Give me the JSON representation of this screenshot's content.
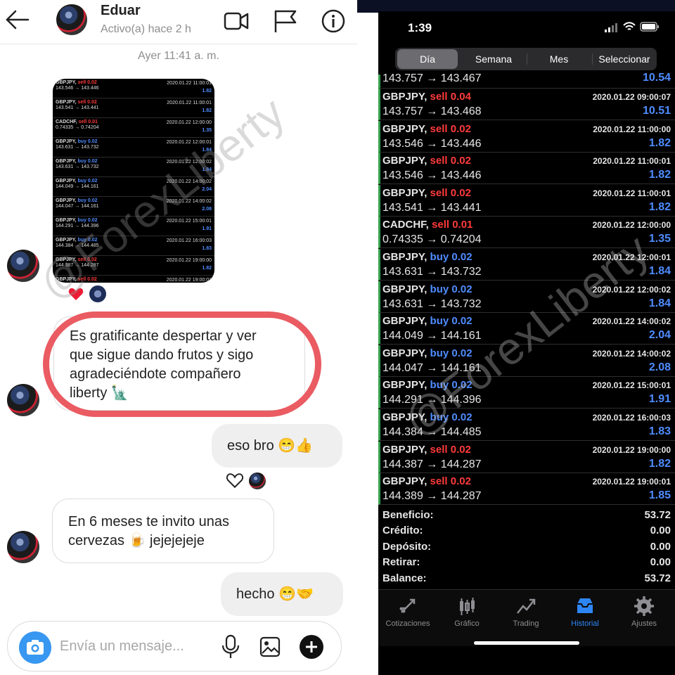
{
  "chat": {
    "contact_name": "Eduar",
    "status": "Activo(a) hace 2 h",
    "date_stamp": "Ayer 11:41 a. m.",
    "image_rows": [
      {
        "symbol": "GBPJPY,",
        "side": "sell 0.02",
        "side_type": "sell",
        "date": "2020.01.22 11:00:01",
        "prices": "143.546 → 143.446",
        "profit": "1.82"
      },
      {
        "symbol": "GBPJPY,",
        "side": "sell 0.02",
        "side_type": "sell",
        "date": "2020.01.22 11:00:01",
        "prices": "143.541 → 143.441",
        "profit": "1.82"
      },
      {
        "symbol": "CADCHF,",
        "side": "sell 0.01",
        "side_type": "sell",
        "date": "2020.01.22 12:00:00",
        "prices": "0.74335 → 0.74204",
        "profit": "1.35"
      },
      {
        "symbol": "GBPJPY,",
        "side": "buy 0.02",
        "side_type": "buy",
        "date": "2020.01.22 12:00:01",
        "prices": "143.631 → 143.732",
        "profit": "1.84"
      },
      {
        "symbol": "GBPJPY,",
        "side": "buy 0.02",
        "side_type": "buy",
        "date": "2020.01.22 12:00:02",
        "prices": "143.631 → 143.732",
        "profit": "1.84"
      },
      {
        "symbol": "GBPJPY,",
        "side": "buy 0.02",
        "side_type": "buy",
        "date": "2020.01.22 14:00:02",
        "prices": "144.049 → 144.161",
        "profit": "2.04"
      },
      {
        "symbol": "GBPJPY,",
        "side": "buy 0.02",
        "side_type": "buy",
        "date": "2020.01.22 14:00:02",
        "prices": "144.047 → 144.161",
        "profit": "2.08"
      },
      {
        "symbol": "GBPJPY,",
        "side": "buy 0.02",
        "side_type": "buy",
        "date": "2020.01.22 15:00:01",
        "prices": "144.291 → 144.396",
        "profit": "1.91"
      },
      {
        "symbol": "GBPJPY,",
        "side": "buy 0.02",
        "side_type": "buy",
        "date": "2020.01.22 16:00:03",
        "prices": "144.384 → 144.485",
        "profit": "1.83"
      },
      {
        "symbol": "GBPJPY,",
        "side": "sell 0.02",
        "side_type": "sell",
        "date": "2020.01.22 19:00:00",
        "prices": "144.387 → 144.287",
        "profit": "1.82"
      },
      {
        "symbol": "GBPJPY,",
        "side": "sell 0.02",
        "side_type": "sell",
        "date": "2020.01.22 19:00:01",
        "prices": "144.389 → 144.287",
        "profit": "1.85"
      }
    ],
    "messages": [
      {
        "dir": "in",
        "text_lines": [
          "Es gratificante despertar y ver",
          "que sigue dando frutos y sigo",
          "agradeciéndote compañero",
          "liberty 🗽"
        ]
      },
      {
        "dir": "out",
        "text_lines": [
          "eso bro 😁👍"
        ]
      },
      {
        "dir": "in",
        "text_lines": [
          "En 6 meses te invito unas",
          "cervezas 🍺 jejejejeje"
        ]
      },
      {
        "dir": "out",
        "text_lines": [
          "hecho 😁🤝"
        ]
      }
    ],
    "composer_placeholder": "Envía un mensaje..."
  },
  "watermark": "@ForexLiberty",
  "trading": {
    "status_time": "1:39",
    "segments": [
      "Día",
      "Semana",
      "Mes",
      "Seleccionar"
    ],
    "selected_segment": "Día",
    "partial_first_row": {
      "prices": "143.757 → 143.467",
      "profit": "10.54"
    },
    "trades": [
      {
        "symbol": "GBPJPY,",
        "side": "sell 0.04",
        "side_type": "sell",
        "date": "2020.01.22 09:00:07",
        "prices": "143.757 → 143.468",
        "profit": "10.51"
      },
      {
        "symbol": "GBPJPY,",
        "side": "sell 0.02",
        "side_type": "sell",
        "date": "2020.01.22 11:00:00",
        "prices": "143.546 → 143.446",
        "profit": "1.82"
      },
      {
        "symbol": "GBPJPY,",
        "side": "sell 0.02",
        "side_type": "sell",
        "date": "2020.01.22 11:00:01",
        "prices": "143.546 → 143.446",
        "profit": "1.82"
      },
      {
        "symbol": "GBPJPY,",
        "side": "sell 0.02",
        "side_type": "sell",
        "date": "2020.01.22 11:00:01",
        "prices": "143.541 → 143.441",
        "profit": "1.82"
      },
      {
        "symbol": "CADCHF,",
        "side": "sell 0.01",
        "side_type": "sell",
        "date": "2020.01.22 12:00:00",
        "prices": "0.74335 → 0.74204",
        "profit": "1.35"
      },
      {
        "symbol": "GBPJPY,",
        "side": "buy 0.02",
        "side_type": "buy",
        "date": "2020.01.22 12:00:01",
        "prices": "143.631 → 143.732",
        "profit": "1.84"
      },
      {
        "symbol": "GBPJPY,",
        "side": "buy 0.02",
        "side_type": "buy",
        "date": "2020.01.22 12:00:02",
        "prices": "143.631 → 143.732",
        "profit": "1.84"
      },
      {
        "symbol": "GBPJPY,",
        "side": "buy 0.02",
        "side_type": "buy",
        "date": "2020.01.22 14:00:02",
        "prices": "144.049 → 144.161",
        "profit": "2.04"
      },
      {
        "symbol": "GBPJPY,",
        "side": "buy 0.02",
        "side_type": "buy",
        "date": "2020.01.22 14:00:02",
        "prices": "144.047 → 144.161",
        "profit": "2.08"
      },
      {
        "symbol": "GBPJPY,",
        "side": "buy 0.02",
        "side_type": "buy",
        "date": "2020.01.22 15:00:01",
        "prices": "144.291 → 144.396",
        "profit": "1.91"
      },
      {
        "symbol": "GBPJPY,",
        "side": "buy 0.02",
        "side_type": "buy",
        "date": "2020.01.22 16:00:03",
        "prices": "144.384 → 144.485",
        "profit": "1.83"
      },
      {
        "symbol": "GBPJPY,",
        "side": "sell 0.02",
        "side_type": "sell",
        "date": "2020.01.22 19:00:00",
        "prices": "144.387 → 144.287",
        "profit": "1.82"
      },
      {
        "symbol": "GBPJPY,",
        "side": "sell 0.02",
        "side_type": "sell",
        "date": "2020.01.22 19:00:01",
        "prices": "144.389 → 144.287",
        "profit": "1.85"
      }
    ],
    "summary": [
      {
        "label": "Beneficio:",
        "value": "53.72"
      },
      {
        "label": "Crédito:",
        "value": "0.00"
      },
      {
        "label": "Depósito:",
        "value": "0.00"
      },
      {
        "label": "Retirar:",
        "value": "0.00"
      },
      {
        "label": "Balance:",
        "value": "53.72"
      }
    ],
    "tabs": [
      {
        "label": "Cotizaciones",
        "icon": "quotes-icon"
      },
      {
        "label": "Gráfico",
        "icon": "chart-icon"
      },
      {
        "label": "Trading",
        "icon": "trading-icon"
      },
      {
        "label": "Historial",
        "icon": "history-icon",
        "active": true
      },
      {
        "label": "Ajustes",
        "icon": "settings-icon"
      }
    ]
  },
  "colors": {
    "sell": "#ff3b3b",
    "buy": "#4f8cff",
    "accent": "#2e86f5",
    "highlight": "#ea5b62",
    "instagram_blue": "#3897f0"
  }
}
